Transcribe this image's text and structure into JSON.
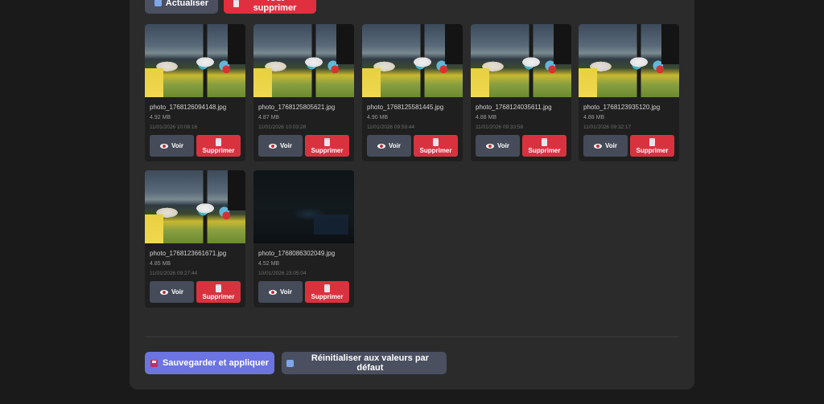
{
  "toolbar": {
    "refresh_label": "Actualiser",
    "delete_all_label": "Tout supprimer"
  },
  "photos": [
    {
      "name": "photo_1768126094148.jpg",
      "size": "4.92 MB",
      "date": "11/01/2026 10:08:16",
      "thumb": "bright"
    },
    {
      "name": "photo_1768125805621.jpg",
      "size": "4.87 MB",
      "date": "11/01/2026 10:03:28",
      "thumb": "bright"
    },
    {
      "name": "photo_1768125581445.jpg",
      "size": "4.90 MB",
      "date": "11/01/2026 09:59:44",
      "thumb": "bright"
    },
    {
      "name": "photo_1768124035611.jpg",
      "size": "4.88 MB",
      "date": "11/01/2026 09:33:58",
      "thumb": "bright"
    },
    {
      "name": "photo_1768123935120.jpg",
      "size": "4.88 MB",
      "date": "11/01/2026 09:32:17",
      "thumb": "bright"
    },
    {
      "name": "photo_1768123661671.jpg",
      "size": "4.85 MB",
      "date": "11/01/2026 09:27:44",
      "thumb": "bright"
    },
    {
      "name": "photo_1768086302049.jpg",
      "size": "4.52 MB",
      "date": "10/01/2026 23:05:04",
      "thumb": "dark"
    }
  ],
  "card_actions": {
    "view_label": "Voir",
    "delete_label": "Supprimer"
  },
  "footer": {
    "save_label": "Sauvegarder et appliquer",
    "reset_label": "Réinitialiser aux valeurs par défaut"
  },
  "colors": {
    "primary": "#6b74e0",
    "danger": "#d9323f",
    "secondary": "#4a5060",
    "panel": "#2b2b2b"
  }
}
